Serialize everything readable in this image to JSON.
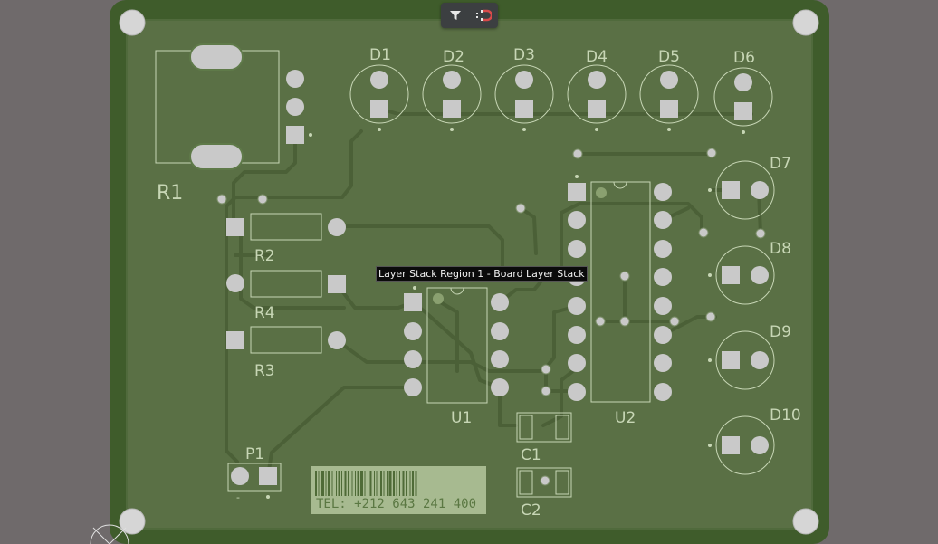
{
  "toolbar": {
    "filter_icon": "filter-icon",
    "snap_icon": "magnet-snap-icon"
  },
  "tooltip": {
    "text": "Layer Stack Region 1 - Board Layer Stack"
  },
  "designators": {
    "R1": "R1",
    "R2": "R2",
    "R3": "R3",
    "R4": "R4",
    "D1": "D1",
    "D2": "D2",
    "D3": "D3",
    "D4": "D4",
    "D5": "D5",
    "D6": "D6",
    "D7": "D7",
    "D8": "D8",
    "D9": "D9",
    "D10": "D10",
    "U1": "U1",
    "U2": "U2",
    "C1": "C1",
    "C2": "C2",
    "P1": "P1"
  },
  "barcode": {
    "text": "TEL: +212 643 241 400"
  },
  "p1_marks": {
    "minus": "-"
  },
  "colors": {
    "background": "#6f6a6b",
    "board_edge": "#3f5c2b",
    "board_fill": "#5a7045",
    "silkscreen": "#c7d6b5",
    "pad": "#c9c9c9",
    "trace": "#4d6238"
  }
}
